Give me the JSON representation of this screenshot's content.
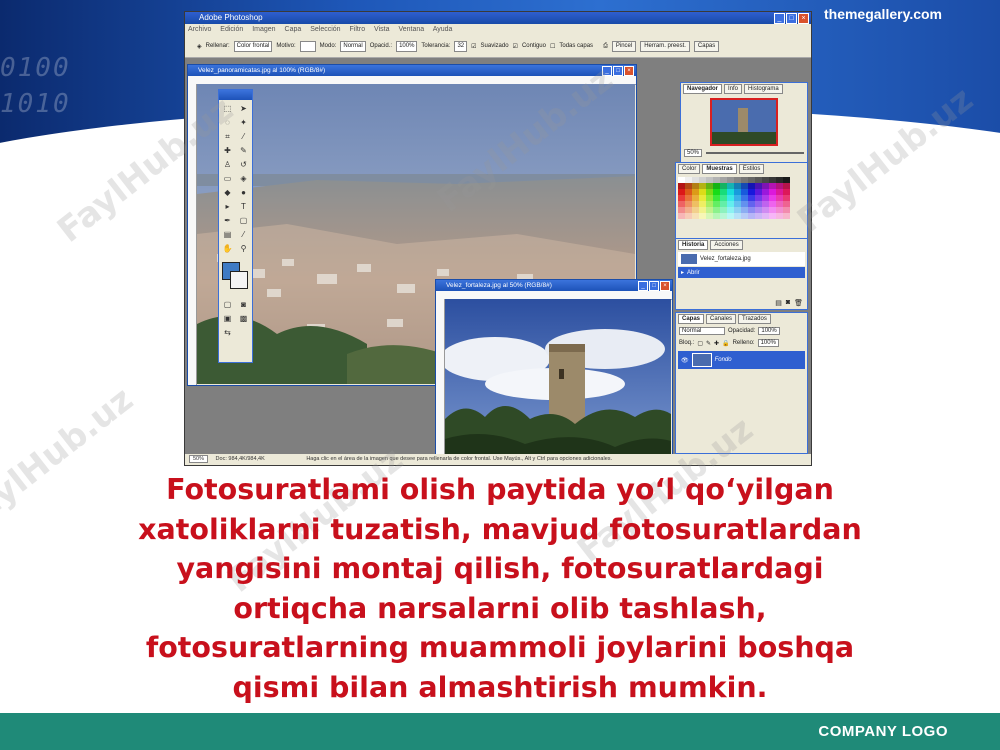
{
  "header": {
    "site": "themegallery.com",
    "binary_lines": [
      "0100",
      "1010"
    ]
  },
  "screenshot": {
    "app_title": "Adobe Photoshop",
    "menus": [
      "Archivo",
      "Edición",
      "Imagen",
      "Capa",
      "Selección",
      "Filtro",
      "Vista",
      "Ventana",
      "Ayuda"
    ],
    "options": {
      "fill_label": "Rellenar:",
      "fill_value": "Color frontal",
      "pattern_label": "Motivo:",
      "mode_label": "Modo:",
      "mode_value": "Normal",
      "opacity_label": "Opacid.:",
      "opacity_value": "100%",
      "tolerance_label": "Tolerancia:",
      "tolerance_value": "32",
      "smoothed_label": "Suavizado",
      "contiguous_label": "Contiguo",
      "all_layers_label": "Todas capas",
      "tab_buttons": [
        "Pincel",
        "Herram. preest.",
        "Capas"
      ]
    },
    "doc1": {
      "title": "Velez_panoramicatas.jpg al 100% (RGB/8#)",
      "zoom": "50%",
      "doc_info": "Doc: 984,4K/984,4K",
      "status_hint": "Haga clic en el área de la imagen que desee para rellenarla de color frontal. Use Mayús., Alt y Ctrl para opciones adicionales."
    },
    "doc2": {
      "title": "Velez_fortaleza.jpg al 50% (RGB/8#)"
    },
    "navigator": {
      "tabs": [
        "Navegador",
        "Info",
        "Histograma"
      ],
      "zoom": "50%"
    },
    "swatches_tabs": [
      "Color",
      "Muestras",
      "Estilos"
    ],
    "history": {
      "tabs": [
        "Historia",
        "Acciones"
      ],
      "items": [
        "Velez_fortaleza.jpg",
        "Abrir"
      ]
    },
    "layers": {
      "tabs": [
        "Capas",
        "Canales",
        "Trazados"
      ],
      "blend": "Normal",
      "opacity_label": "Opacidad:",
      "opacity_value": "100%",
      "lock_label": "Bloq.:",
      "fill_label": "Relleno:",
      "fill_value": "100%",
      "layer_name": "Fondo"
    }
  },
  "body": {
    "lines": [
      "Fotosuratlami olish paytida yo‘l qo‘yilgan",
      "xatoliklarni tuzatish, mavjud fotosuratlardan",
      "yangisini montaj qilish, fotosuratlardagi",
      "ortiqcha narsalarni olib tashlash,",
      "fotosuratlarning muammoli joylarini boshqa",
      "qismi bilan almashtirish mumkin."
    ]
  },
  "watermark": "FaylHub.uz",
  "footer": {
    "company": "COMPANY LOGO"
  }
}
